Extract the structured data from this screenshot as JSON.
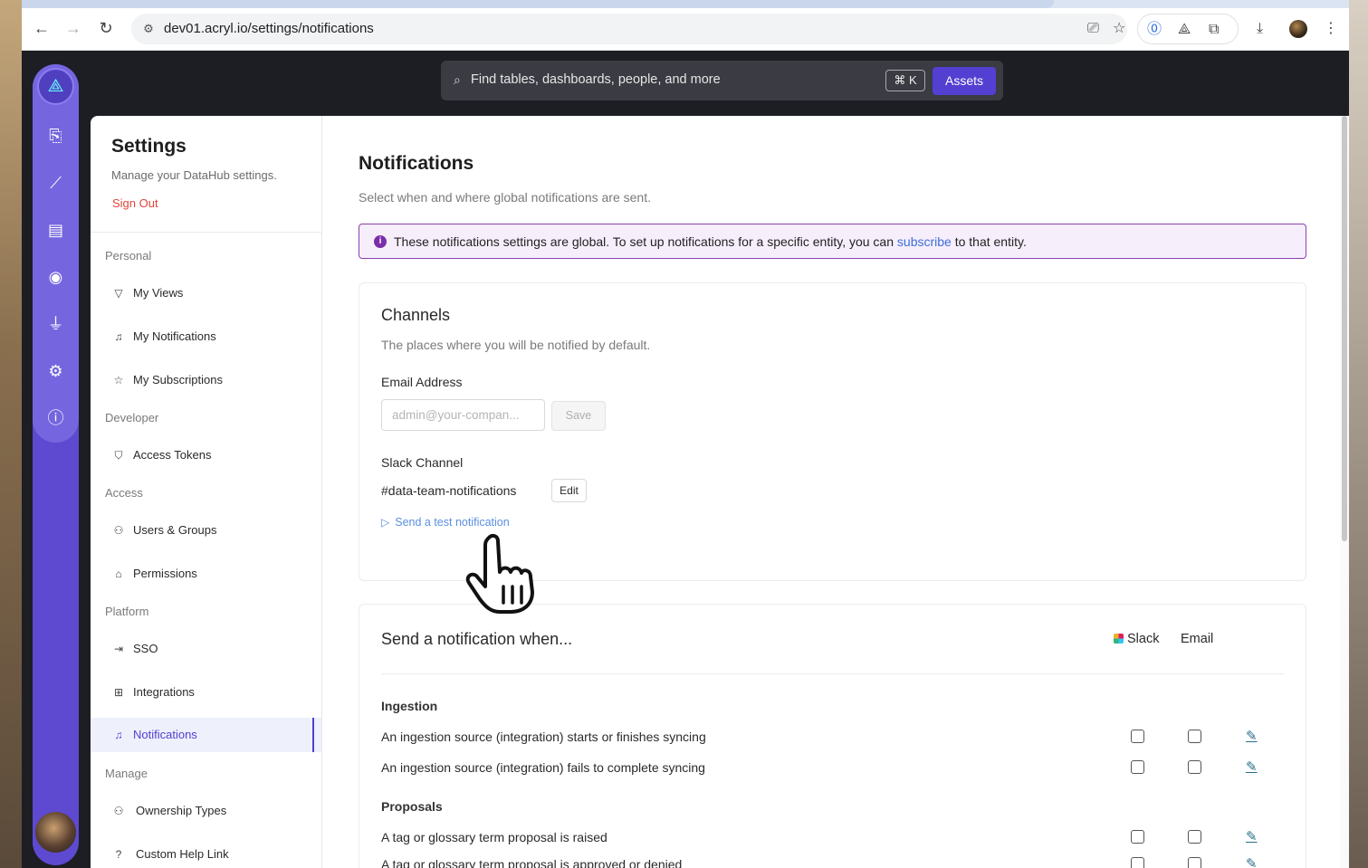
{
  "browser": {
    "url": "dev01.acryl.io/settings/notifications"
  },
  "search": {
    "placeholder": "Find tables, dashboards, people, and more",
    "shortcut": "⌘ K",
    "scope_button": "Assets"
  },
  "rail": {
    "icons": [
      "home-logo",
      "inbox-icon",
      "analytics-icon",
      "report-icon",
      "eye-icon",
      "plug-icon",
      "gear-icon",
      "help-icon"
    ]
  },
  "sidebar": {
    "title": "Settings",
    "subtitle": "Manage your DataHub settings.",
    "sign_out": "Sign Out",
    "sections": {
      "personal": "Personal",
      "developer": "Developer",
      "access": "Access",
      "platform": "Platform",
      "manage": "Manage"
    },
    "items": {
      "my_views": "My Views",
      "my_notifications": "My Notifications",
      "my_subscriptions": "My Subscriptions",
      "access_tokens": "Access Tokens",
      "users_groups": "Users & Groups",
      "permissions": "Permissions",
      "sso": "SSO",
      "integrations": "Integrations",
      "notifications": "Notifications",
      "ownership_types": "Ownership Types",
      "custom_help_link": "Custom Help Link"
    },
    "active_item": "Notifications"
  },
  "main": {
    "title": "Notifications",
    "subtitle": "Select when and where global notifications are sent.",
    "banner": {
      "text_before": "These notifications settings are global. To set up notifications for a specific entity, you can ",
      "link": "subscribe",
      "text_after": " to that entity."
    },
    "channels": {
      "title": "Channels",
      "subtitle": "The places where you will be notified by default.",
      "email_label": "Email Address",
      "email_placeholder": "admin@your-compan...",
      "email_value": "",
      "save": "Save",
      "slack_label": "Slack Channel",
      "slack_channel": "#data-team-notifications",
      "edit": "Edit",
      "test_link": "Send a test notification"
    },
    "send_when": {
      "title": "Send a notification when...",
      "col_slack": "Slack",
      "col_email": "Email",
      "groups": {
        "ingestion": "Ingestion",
        "proposals": "Proposals"
      },
      "rows": {
        "r1": "An ingestion source (integration) starts or finishes syncing",
        "r2": "An ingestion source (integration) fails to complete syncing",
        "r3": "A tag or glossary term proposal is raised",
        "r4": "A tag or glossary term proposal is approved or denied"
      }
    }
  },
  "colors": {
    "accent": "#533fd1",
    "rail": "#5d4ad0",
    "banner_border": "#8b3fb0",
    "sign_out": "#e0453b",
    "link": "#3a6fd8"
  }
}
